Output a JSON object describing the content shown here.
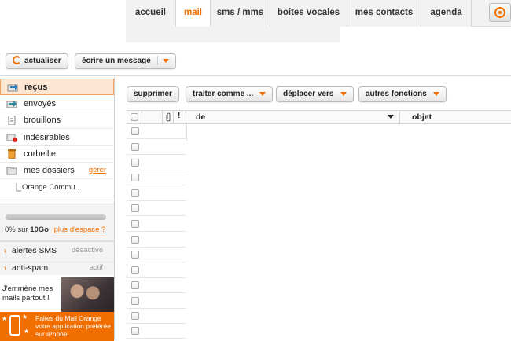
{
  "tabs": [
    {
      "label": "accueil",
      "active": false
    },
    {
      "label": "mail",
      "active": true
    },
    {
      "label": "sms / mms",
      "active": false
    },
    {
      "label": "boîtes vocales",
      "active": false
    },
    {
      "label": "mes contacts",
      "active": false
    },
    {
      "label": "agenda",
      "active": false
    }
  ],
  "toolbar": {
    "refresh_label": "actualiser",
    "compose_label": "écrire un message"
  },
  "folders": [
    {
      "label": "reçus",
      "icon": "inbox-icon",
      "active": true
    },
    {
      "label": "envoyés",
      "icon": "sent-icon",
      "active": false
    },
    {
      "label": "brouillons",
      "icon": "draft-icon",
      "active": false
    },
    {
      "label": "indésirables",
      "icon": "spam-icon",
      "active": false
    },
    {
      "label": "corbeille",
      "icon": "trash-icon",
      "active": false
    },
    {
      "label": "mes dossiers",
      "icon": "folder-icon",
      "active": false,
      "action": "gérer"
    }
  ],
  "subfolder": {
    "label": "Orange Commu..."
  },
  "quota": {
    "prefix": "0% sur ",
    "size": "10Go",
    "link": "plus d'espace ?",
    "used_fraction": 0
  },
  "options": [
    {
      "label": "alertes SMS",
      "state": "désactivé"
    },
    {
      "label": "anti-spam",
      "state": "actif"
    }
  ],
  "promo": {
    "text": "J'emmène mes mails partout !",
    "banner": "Faites du Mail Orange votre application préférée sur iPhone"
  },
  "actions": {
    "delete": "supprimer",
    "mark_as": "traiter comme ...",
    "move_to": "déplacer vers",
    "more": "autres fonctions"
  },
  "list_header": {
    "from": "de",
    "subject": "objet"
  },
  "row_count": 14,
  "colors": {
    "accent": "#f16e00",
    "selected_bg": "#fde6d2"
  }
}
